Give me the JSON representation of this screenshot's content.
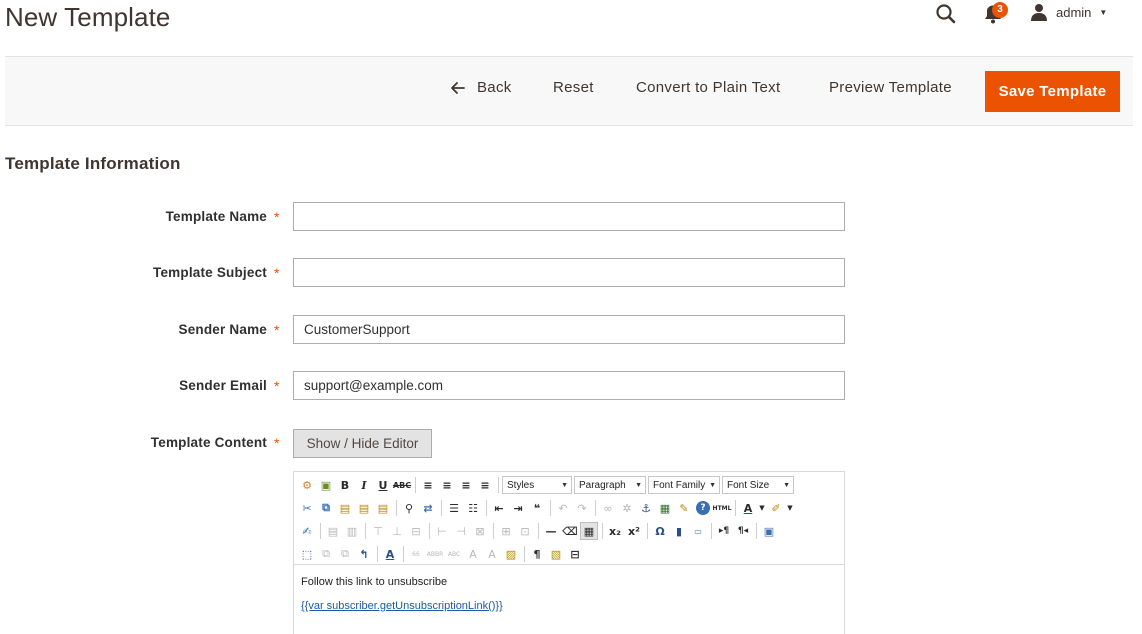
{
  "header": {
    "page_title": "New Template",
    "notifications_count": "3",
    "user_name": "admin"
  },
  "toolbar": {
    "back_label": "Back",
    "reset_label": "Reset",
    "convert_label": "Convert to Plain Text",
    "preview_label": "Preview Template",
    "save_label": "Save Template"
  },
  "section": {
    "title": "Template Information"
  },
  "fields": {
    "template_name": {
      "label": "Template Name",
      "value": ""
    },
    "template_subject": {
      "label": "Template Subject",
      "value": ""
    },
    "sender_name": {
      "label": "Sender Name",
      "value": "CustomerSupport"
    },
    "sender_email": {
      "label": "Sender Email",
      "value": "support@example.com"
    },
    "template_content": {
      "label": "Template Content"
    },
    "required_marker": "*"
  },
  "editor": {
    "show_hide_label": "Show / Hide Editor",
    "styles_select": "Styles",
    "format_select": "Paragraph",
    "font_family_select": "Font Family",
    "font_size_select": "Font Size",
    "body_text": "Follow this link to unsubscribe",
    "link_text": "{{var subscriber.getUnsubscriptionLink()}}"
  },
  "colors": {
    "accent": "#eb5202",
    "text_dark": "#41362f",
    "link": "#1a5aa6"
  }
}
